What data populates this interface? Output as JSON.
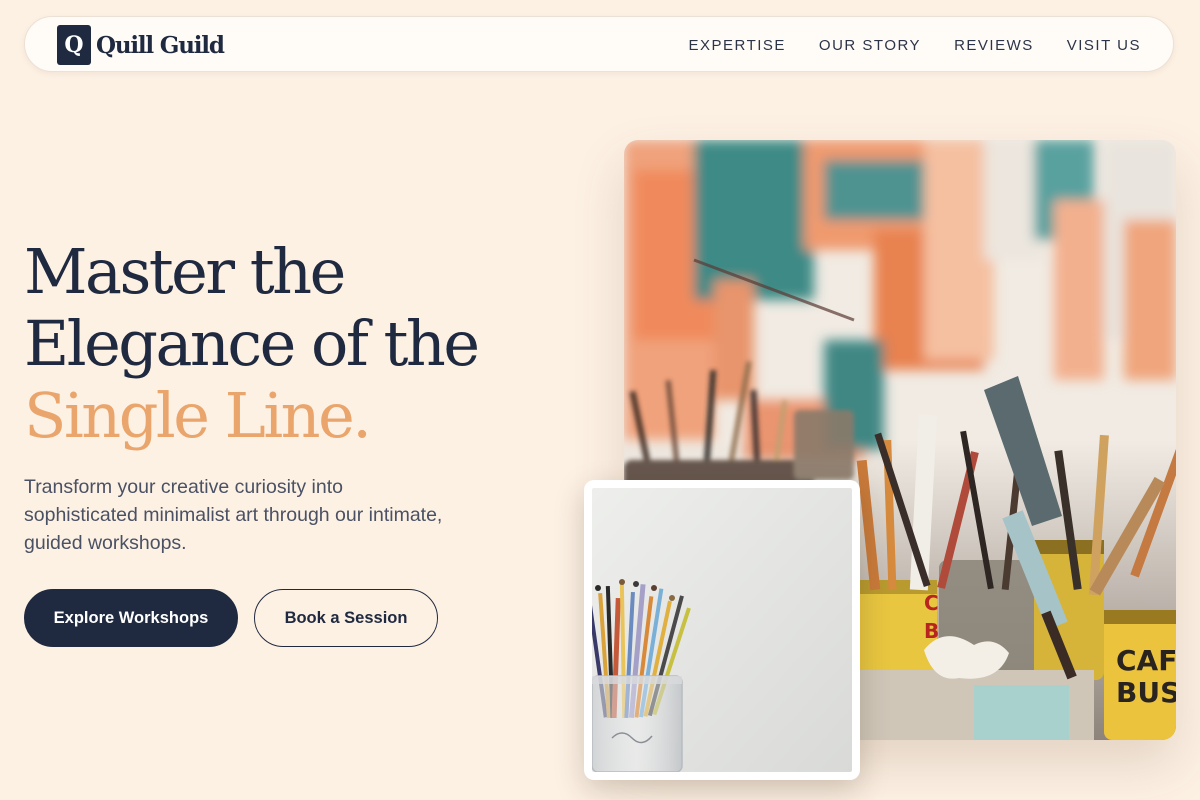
{
  "brand": {
    "logo_letter": "Q",
    "name": "Quill Guild"
  },
  "nav": {
    "items": [
      {
        "label": "EXPERTISE"
      },
      {
        "label": "OUR STORY"
      },
      {
        "label": "REVIEWS"
      },
      {
        "label": "VISIT US"
      }
    ]
  },
  "hero": {
    "headline_line1": "Master the",
    "headline_line2": "Elegance of the",
    "headline_accent": "Single Line.",
    "description": "Transform your creative curiosity into sophisticated minimalist art through our intimate, guided workshops.",
    "primary_button": "Explore Workshops",
    "secondary_button": "Book a Session"
  },
  "images": {
    "main": "photo of paint brushes in cans in front of a painted wall",
    "inset": "photo of paint brushes in a glass jar"
  },
  "colors": {
    "background": "#fdf1e4",
    "navy": "#1f2a40",
    "accent": "#eaa56c"
  }
}
